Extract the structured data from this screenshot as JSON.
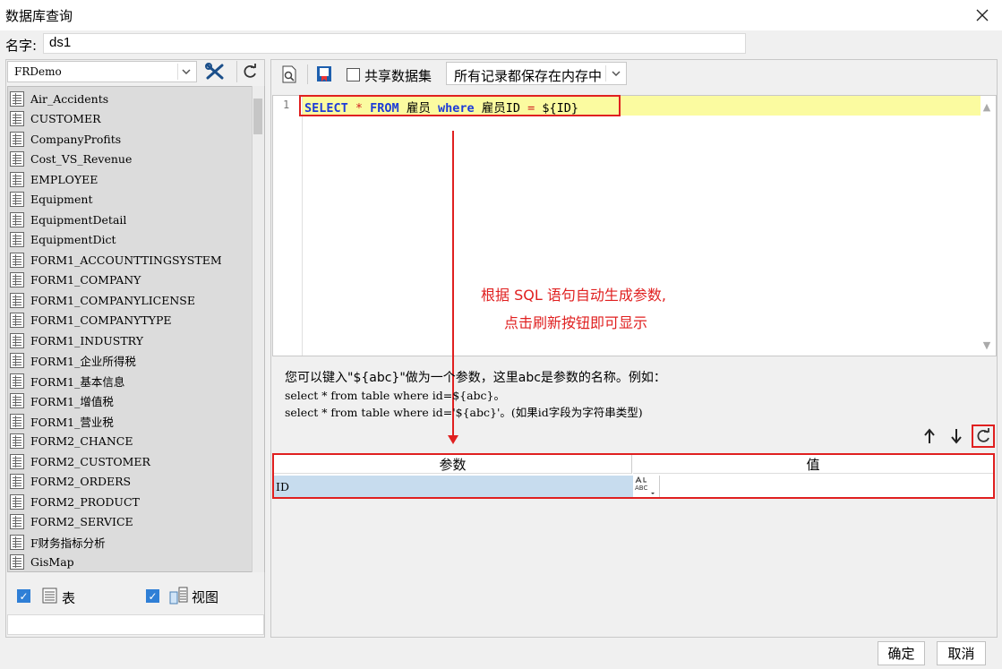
{
  "window": {
    "title": "数据库查询"
  },
  "name_field": {
    "label": "名字:",
    "value": "ds1"
  },
  "database": {
    "selected": "FRDemo"
  },
  "tables": [
    "Air_Accidents",
    "CUSTOMER",
    "CompanyProfits",
    "Cost_VS_Revenue",
    "EMPLOYEE",
    "Equipment",
    "EquipmentDetail",
    "EquipmentDict",
    "FORM1_ACCOUNTTINGSYSTEM",
    "FORM1_COMPANY",
    "FORM1_COMPANYLICENSE",
    "FORM1_COMPANYTYPE",
    "FORM1_INDUSTRY",
    "FORM1_企业所得税",
    "FORM1_基本信息",
    "FORM1_增值税",
    "FORM1_营业税",
    "FORM2_CHANCE",
    "FORM2_CUSTOMER",
    "FORM2_ORDERS",
    "FORM2_PRODUCT",
    "FORM2_SERVICE",
    "F财务指标分析",
    "GisMap"
  ],
  "filters": {
    "table_label": "表",
    "view_label": "视图"
  },
  "toolbar": {
    "shared_label": "共享数据集",
    "cache_option": "所有记录都保存在内存中"
  },
  "editor": {
    "line_number": "1",
    "sql": {
      "k1": "SELECT",
      "star": " * ",
      "k2": "FROM",
      "t1": " 雇员 ",
      "k3": "where",
      "t2": " 雇员ID ",
      "eq": "=",
      "t3": " ${ID}"
    }
  },
  "annotation": {
    "line1": "根据 SQL 语句自动生成参数,",
    "line2": "点击刷新按钮即可显示"
  },
  "hint": {
    "line1": "您可以键入\"${abc}\"做为一个参数，这里abc是参数的名称。例如：",
    "line2": "select * from table where id=${abc}。",
    "line3": "select * from table where id='${abc}'。(如果id字段为字符串类型)"
  },
  "params": {
    "col_param": "参数",
    "col_value": "值",
    "rows": [
      {
        "name": "ID",
        "value": ""
      }
    ]
  },
  "buttons": {
    "ok": "确定",
    "cancel": "取消"
  }
}
